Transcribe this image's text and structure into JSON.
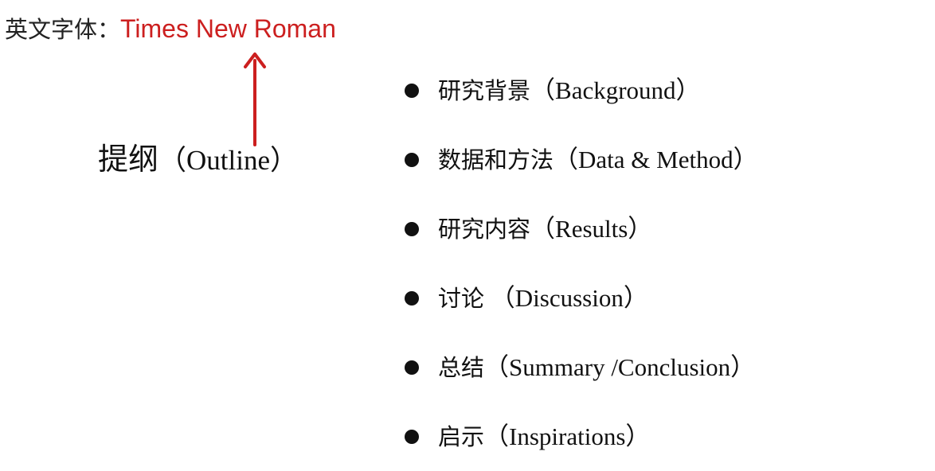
{
  "font_note": {
    "label": "英文字体：",
    "value": "Times New Roman"
  },
  "outline": {
    "title_zh": "提纲",
    "title_en": "（Outline）"
  },
  "items": [
    {
      "zh": "研究背景",
      "en": "（Background）"
    },
    {
      "zh": "数据和方法",
      "en": "（Data & Method）"
    },
    {
      "zh": "研究内容",
      "en": "（Results）"
    },
    {
      "zh": "讨论",
      "en": " （Discussion）"
    },
    {
      "zh": "总结",
      "en": "（Summary /Conclusion）"
    },
    {
      "zh": "启示",
      "en": "（Inspirations）"
    }
  ],
  "colors": {
    "annotation": "#cc1f1f",
    "text": "#111111"
  }
}
